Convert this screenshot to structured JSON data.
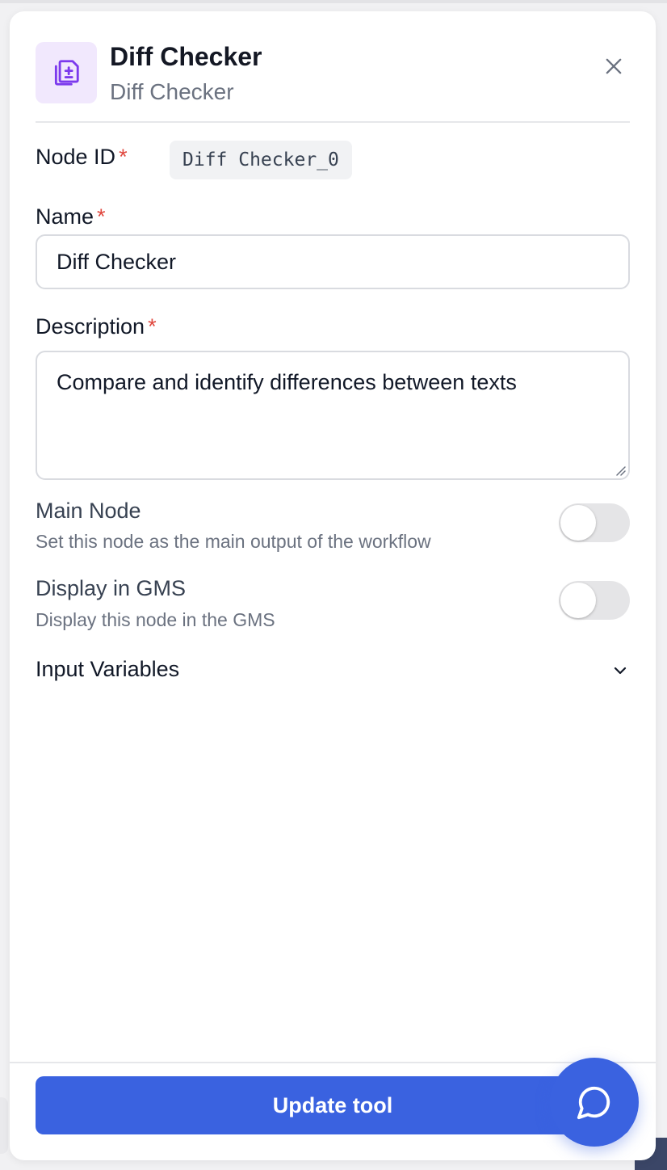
{
  "header": {
    "title": "Diff Checker",
    "subtitle": "Diff Checker",
    "icon": "document-diff-icon",
    "icon_color": "#7c3aed",
    "icon_bg": "#f1e8fd"
  },
  "node_id": {
    "label": "Node ID",
    "required_mark": "*",
    "value": "Diff Checker_0"
  },
  "name_field": {
    "label": "Name",
    "required_mark": "*",
    "value": "Diff Checker"
  },
  "description_field": {
    "label": "Description",
    "required_mark": "*",
    "value": "Compare and identify differences between texts"
  },
  "main_node": {
    "title": "Main Node",
    "description": "Set this node as the main output of the workflow",
    "enabled": false
  },
  "display_gms": {
    "title": "Display in GMS",
    "description": "Display this node in the GMS",
    "enabled": false
  },
  "input_variables": {
    "label": "Input Variables",
    "expanded": false
  },
  "footer": {
    "update_label": "Update tool",
    "accent": "#3a62e0"
  }
}
